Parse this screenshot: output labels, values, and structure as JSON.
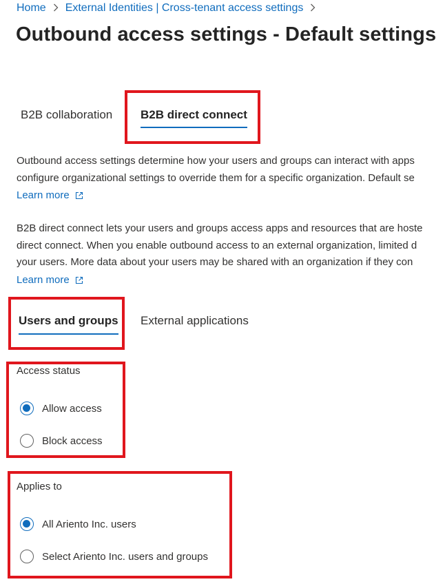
{
  "breadcrumb": {
    "home": "Home",
    "sep": ">",
    "section": "External Identities | Cross-tenant access settings",
    "trailing_sep": ">"
  },
  "page_title": "Outbound access settings - Default settings",
  "top_tabs": [
    {
      "label": "B2B collaboration",
      "selected": false
    },
    {
      "label": "B2B direct connect",
      "selected": true
    }
  ],
  "intro": {
    "lines": [
      "Outbound access settings determine how your users and groups can interact with apps",
      "configure organizational settings to override them for a specific organization. Default se"
    ],
    "learn_more": "Learn more"
  },
  "direct_connect": {
    "lines": [
      "B2B direct connect lets your users and groups access apps and resources that are hoste",
      "direct connect. When you enable outbound access to an external organization, limited d",
      "your users. More data about your users may be shared with an organization if they con"
    ],
    "learn_more": "Learn more"
  },
  "sub_tabs": [
    {
      "label": "Users and groups",
      "selected": true
    },
    {
      "label": "External applications",
      "selected": false
    }
  ],
  "access_status": {
    "label": "Access status",
    "options": [
      {
        "label": "Allow access",
        "checked": true
      },
      {
        "label": "Block access",
        "checked": false
      }
    ]
  },
  "applies_to": {
    "label": "Applies to",
    "options": [
      {
        "label": "All Ariento Inc. users",
        "checked": true
      },
      {
        "label": "Select Ariento Inc. users and groups",
        "checked": false
      }
    ]
  },
  "colors": {
    "accent": "#0f6cbd",
    "highlight": "#e0161d"
  },
  "icons": [
    "chevron-right-icon",
    "external-link-icon"
  ]
}
